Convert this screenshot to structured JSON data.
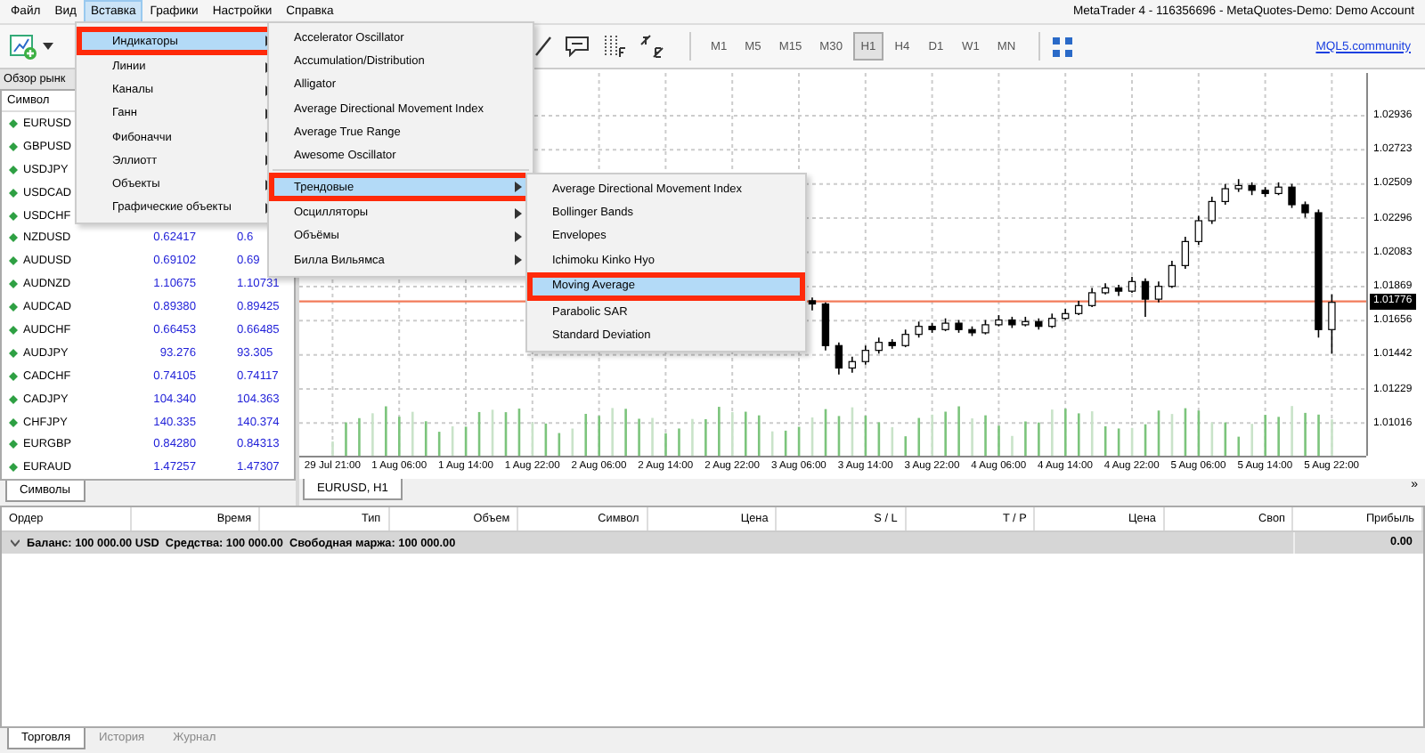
{
  "window": {
    "title": "MetaTrader 4 - 116356696 - MetaQuotes-Demo: Demo Account"
  },
  "menu_bar": [
    {
      "label": "Файл",
      "selected": false
    },
    {
      "label": "Вид",
      "selected": false
    },
    {
      "label": "Вставка",
      "selected": true
    },
    {
      "label": "Графики",
      "selected": false
    },
    {
      "label": "Настройки",
      "selected": false
    },
    {
      "label": "Справка",
      "selected": false
    }
  ],
  "toolbar": {
    "timeframes": [
      {
        "label": "M1",
        "selected": false
      },
      {
        "label": "M5",
        "selected": false
      },
      {
        "label": "M15",
        "selected": false
      },
      {
        "label": "M30",
        "selected": false
      },
      {
        "label": "H1",
        "selected": true
      },
      {
        "label": "H4",
        "selected": false
      },
      {
        "label": "D1",
        "selected": false
      },
      {
        "label": "W1",
        "selected": false
      },
      {
        "label": "MN",
        "selected": false
      }
    ],
    "link": "MQL5.community"
  },
  "menus": [
    {
      "items": [
        {
          "kind": "item",
          "label": "Индикаторы",
          "selected": true,
          "submenu": true
        },
        {
          "kind": "item",
          "label": "Линии",
          "selected": false,
          "submenu": true
        },
        {
          "kind": "item",
          "label": "Каналы",
          "selected": false,
          "submenu": true
        },
        {
          "kind": "item",
          "label": "Ганн",
          "selected": false,
          "submenu": true
        },
        {
          "kind": "item",
          "label": "Фибоначчи",
          "selected": false,
          "submenu": true
        },
        {
          "kind": "item",
          "label": "Эллиотт",
          "selected": false,
          "submenu": true
        },
        {
          "kind": "item",
          "label": "Объекты",
          "selected": false,
          "submenu": true
        },
        {
          "kind": "item",
          "label": "Графические объекты",
          "selected": false,
          "submenu": true
        }
      ]
    },
    {
      "items": [
        {
          "kind": "item",
          "label": "Accelerator Oscillator",
          "selected": false,
          "submenu": false
        },
        {
          "kind": "item",
          "label": "Accumulation/Distribution",
          "selected": false,
          "submenu": false
        },
        {
          "kind": "item",
          "label": "Alligator",
          "selected": false,
          "submenu": false
        },
        {
          "kind": "item",
          "label": "Average Directional Movement Index",
          "selected": false,
          "submenu": false
        },
        {
          "kind": "item",
          "label": "Average True Range",
          "selected": false,
          "submenu": false
        },
        {
          "kind": "item",
          "label": "Awesome Oscillator",
          "selected": false,
          "submenu": false
        },
        {
          "kind": "separator"
        },
        {
          "kind": "item",
          "label": "Трендовые",
          "selected": true,
          "submenu": true
        },
        {
          "kind": "item",
          "label": "Осцилляторы",
          "selected": false,
          "submenu": true
        },
        {
          "kind": "item",
          "label": "Объёмы",
          "selected": false,
          "submenu": true
        },
        {
          "kind": "item",
          "label": "Билла Вильямса",
          "selected": false,
          "submenu": true
        }
      ]
    },
    {
      "items": [
        {
          "kind": "item",
          "label": "Average Directional Movement Index",
          "selected": false,
          "submenu": false
        },
        {
          "kind": "item",
          "label": "Bollinger Bands",
          "selected": false,
          "submenu": false
        },
        {
          "kind": "item",
          "label": "Envelopes",
          "selected": false,
          "submenu": false
        },
        {
          "kind": "item",
          "label": "Ichimoku Kinko Hyo",
          "selected": false,
          "submenu": false
        },
        {
          "kind": "item",
          "label": "Moving Average",
          "selected": true,
          "submenu": false
        },
        {
          "kind": "item",
          "label": "Parabolic SAR",
          "selected": false,
          "submenu": false
        },
        {
          "kind": "item",
          "label": "Standard Deviation",
          "selected": false,
          "submenu": false
        }
      ]
    }
  ],
  "market_watch": {
    "title": "Обзор рынк",
    "column": "Символ",
    "rows": [
      {
        "symbol": "EURUSD"
      },
      {
        "symbol": "GBPUSD"
      },
      {
        "symbol": "USDJPY"
      },
      {
        "symbol": "USDCAD"
      },
      {
        "symbol": "USDCHF"
      },
      {
        "symbol": "NZDUSD",
        "bid": "0.62417",
        "ask": "0.6"
      },
      {
        "symbol": "AUDUSD",
        "bid": "0.69102",
        "ask": "0.69"
      },
      {
        "symbol": "AUDNZD",
        "bid": "1.10675",
        "ask": "1.10731"
      },
      {
        "symbol": "AUDCAD",
        "bid": "0.89380",
        "ask": "0.89425"
      },
      {
        "symbol": "AUDCHF",
        "bid": "0.66453",
        "ask": "0.66485"
      },
      {
        "symbol": "AUDJPY",
        "bid": "93.276",
        "ask": "93.305"
      },
      {
        "symbol": "CADCHF",
        "bid": "0.74105",
        "ask": "0.74117"
      },
      {
        "symbol": "CADJPY",
        "bid": "104.340",
        "ask": "104.363"
      },
      {
        "symbol": "CHFJPY",
        "bid": "140.335",
        "ask": "140.374"
      },
      {
        "symbol": "EURGBP",
        "bid": "0.84280",
        "ask": "0.84313"
      },
      {
        "symbol": "EURAUD",
        "bid": "1.47257",
        "ask": "1.47307"
      }
    ],
    "tabs": [
      {
        "label": "Символы",
        "selected": true
      }
    ]
  },
  "chart": {
    "current_price": "1.01776",
    "chart_data": {
      "type": "candlestick",
      "categories": [
        "29 Jul 21:00",
        null,
        null,
        null,
        null,
        "1 Aug 06:00",
        null,
        null,
        null,
        null,
        "1 Aug 14:00",
        null,
        null,
        null,
        null,
        "1 Aug 22:00",
        null,
        null,
        null,
        null,
        "2 Aug 06:00",
        null,
        null,
        null,
        null,
        "2 Aug 14:00",
        null,
        null,
        null,
        null,
        "2 Aug 22:00",
        null,
        null,
        null,
        null,
        "3 Aug 06:00",
        null,
        null,
        null,
        null,
        "3 Aug 14:00",
        null,
        null,
        null,
        null,
        "3 Aug 22:00",
        null,
        null,
        null,
        null,
        "4 Aug 06:00",
        null,
        null,
        null,
        null,
        "4 Aug 14:00",
        null,
        null,
        null,
        null,
        "4 Aug 22:00",
        null,
        null,
        null,
        null,
        "5 Aug 06:00",
        null,
        null,
        null,
        null,
        "5 Aug 14:00",
        null,
        null,
        null,
        null,
        "5 Aug 22:00"
      ],
      "ylim": [
        1.00812,
        1.03203
      ],
      "grid": true,
      "ref_lines": [
        {
          "axis": "y",
          "value": 1.01776,
          "color": "#f27b5a"
        }
      ],
      "ohlc": [
        null,
        null,
        null,
        null,
        null,
        null,
        null,
        null,
        null,
        null,
        null,
        null,
        null,
        null,
        null,
        null,
        null,
        null,
        null,
        null,
        null,
        null,
        null,
        null,
        null,
        null,
        null,
        null,
        null,
        null,
        null,
        null,
        null,
        null,
        null,
        null,
        [
          1.0178,
          1.018,
          1.0172,
          1.0176
        ],
        [
          1.0176,
          1.0177,
          1.0147,
          1.015
        ],
        [
          1.015,
          1.0152,
          1.0132,
          1.0136
        ],
        [
          1.0136,
          1.0143,
          1.0133,
          1.014
        ],
        [
          1.014,
          1.015,
          1.0138,
          1.0147
        ],
        [
          1.0147,
          1.0155,
          1.0145,
          1.0152
        ],
        [
          1.0152,
          1.0154,
          1.0148,
          1.015
        ],
        [
          1.015,
          1.016,
          1.0149,
          1.0157
        ],
        [
          1.0157,
          1.0165,
          1.0155,
          1.0162
        ],
        [
          1.0162,
          1.0164,
          1.0158,
          1.016
        ],
        [
          1.016,
          1.0167,
          1.0159,
          1.0164
        ],
        [
          1.0164,
          1.0166,
          1.0158,
          1.016
        ],
        [
          1.016,
          1.0162,
          1.0156,
          1.0158
        ],
        [
          1.0158,
          1.0166,
          1.0157,
          1.0163
        ],
        [
          1.0163,
          1.0169,
          1.0162,
          1.0166
        ],
        [
          1.0166,
          1.0168,
          1.0161,
          1.0163
        ],
        [
          1.0163,
          1.0168,
          1.0162,
          1.0165
        ],
        [
          1.0165,
          1.0167,
          1.016,
          1.0162
        ],
        [
          1.0162,
          1.017,
          1.0161,
          1.0167
        ],
        [
          1.0167,
          1.0173,
          1.0166,
          1.017
        ],
        [
          1.017,
          1.0178,
          1.0169,
          1.0175
        ],
        [
          1.0175,
          1.0186,
          1.0174,
          1.0183
        ],
        [
          1.0183,
          1.0189,
          1.0182,
          1.0186
        ],
        [
          1.0186,
          1.0188,
          1.0181,
          1.0184
        ],
        [
          1.0184,
          1.0193,
          1.0183,
          1.019
        ],
        [
          1.019,
          1.0192,
          1.0168,
          1.0179
        ],
        [
          1.0179,
          1.019,
          1.0177,
          1.0187
        ],
        [
          1.0187,
          1.0203,
          1.0186,
          1.02
        ],
        [
          1.02,
          1.0218,
          1.0198,
          1.0215
        ],
        [
          1.0215,
          1.0231,
          1.0213,
          1.0228
        ],
        [
          1.0228,
          1.0243,
          1.0226,
          1.024
        ],
        [
          1.024,
          1.0251,
          1.0238,
          1.0248
        ],
        [
          1.0248,
          1.0254,
          1.0246,
          1.025
        ],
        [
          1.025,
          1.0252,
          1.0244,
          1.0247
        ],
        [
          1.0247,
          1.0249,
          1.0243,
          1.0245
        ],
        [
          1.0245,
          1.0252,
          1.0244,
          1.0249
        ],
        [
          1.0249,
          1.0251,
          1.0236,
          1.0238
        ],
        [
          1.0238,
          1.024,
          1.023,
          1.0233
        ],
        [
          1.0233,
          1.0235,
          1.0155,
          1.016
        ],
        [
          1.016,
          1.0182,
          1.0145,
          1.0177
        ]
      ],
      "yticks": [
        {
          "value": 1.02936,
          "label": "1.02936"
        },
        {
          "value": 1.02723,
          "label": "1.02723"
        },
        {
          "value": 1.02509,
          "label": "1.02509"
        },
        {
          "value": 1.02296,
          "label": "1.02296"
        },
        {
          "value": 1.02083,
          "label": "1.02083"
        },
        {
          "value": 1.01869,
          "label": "1.01869"
        },
        {
          "value": 1.01656,
          "label": "1.01656"
        },
        {
          "value": 1.01442,
          "label": "1.01442"
        },
        {
          "value": 1.01229,
          "label": "1.01229"
        },
        {
          "value": 1.01016,
          "label": "1.01016"
        }
      ]
    },
    "tabs": [
      {
        "label": "EURUSD, H1",
        "selected": true
      }
    ],
    "scroll_button": "»"
  },
  "terminal": {
    "columns": [
      "Ордер",
      "Время",
      "Тип",
      "Объем",
      "Символ",
      "Цена",
      "S / L",
      "T / P",
      "Цена",
      "Своп",
      "Прибыль"
    ],
    "balance": {
      "text": "Баланс: 100 000.00 USD  Средства: 100 000.00  Свободная маржа: 100 000.00",
      "profit": "0.00"
    },
    "tabs": [
      {
        "label": "Торговля",
        "selected": true
      },
      {
        "label": "История",
        "selected": false
      },
      {
        "label": "Журнал",
        "selected": false
      }
    ]
  }
}
